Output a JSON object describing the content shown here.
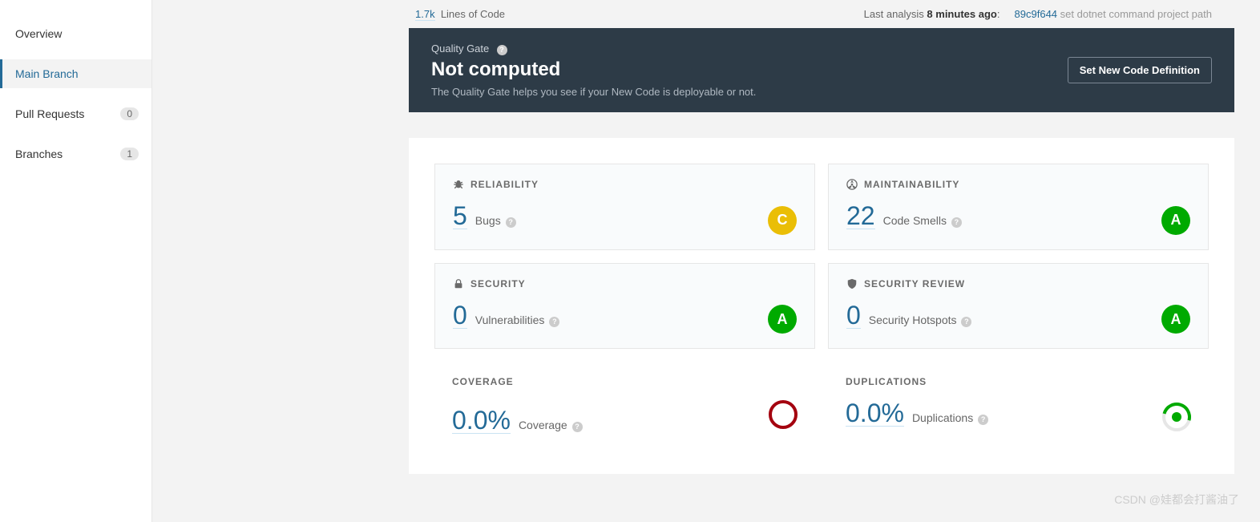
{
  "sidebar": {
    "items": [
      {
        "label": "Overview",
        "count": null,
        "active": false
      },
      {
        "label": "Main Branch",
        "count": null,
        "active": true
      },
      {
        "label": "Pull Requests",
        "count": "0",
        "active": false
      },
      {
        "label": "Branches",
        "count": "1",
        "active": false
      }
    ]
  },
  "topbar": {
    "loc_value": "1.7k",
    "loc_label": "Lines of Code",
    "last_analysis_prefix": "Last analysis ",
    "last_analysis_time": "8 minutes ago",
    "last_analysis_suffix": ":",
    "commit_hash": "89c9f644",
    "commit_msg": "set dotnet command project path"
  },
  "quality_gate": {
    "title": "Quality Gate",
    "status": "Not computed",
    "description": "The Quality Gate helps you see if your New Code is deployable or not.",
    "button": "Set New Code Definition"
  },
  "metrics": {
    "reliability": {
      "header": "RELIABILITY",
      "value": "5",
      "label": "Bugs",
      "rating": "C"
    },
    "maintainability": {
      "header": "MAINTAINABILITY",
      "value": "22",
      "label": "Code Smells",
      "rating": "A"
    },
    "security": {
      "header": "SECURITY",
      "value": "0",
      "label": "Vulnerabilities",
      "rating": "A"
    },
    "security_review": {
      "header": "SECURITY REVIEW",
      "value": "0",
      "label": "Security Hotspots",
      "rating": "A"
    },
    "coverage": {
      "header": "COVERAGE",
      "value": "0.0%",
      "label": "Coverage"
    },
    "duplications": {
      "header": "DUPLICATIONS",
      "value": "0.0%",
      "label": "Duplications"
    }
  },
  "watermark": "CSDN @娃都会打酱油了"
}
